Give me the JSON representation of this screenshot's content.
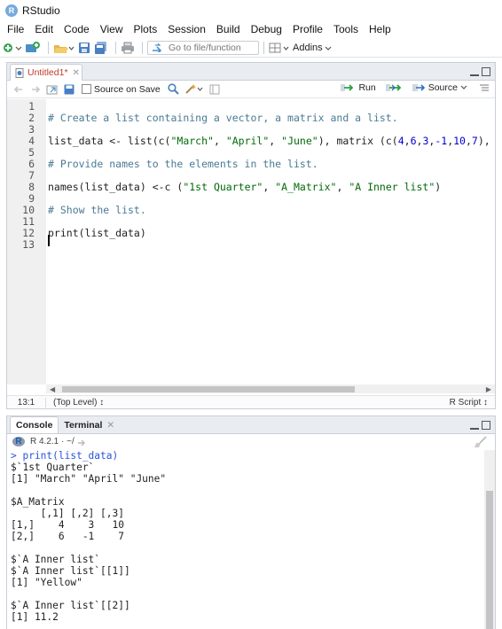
{
  "window": {
    "title": "RStudio"
  },
  "menu": [
    "File",
    "Edit",
    "Code",
    "View",
    "Plots",
    "Session",
    "Build",
    "Debug",
    "Profile",
    "Tools",
    "Help"
  ],
  "toolbar": {
    "goto_placeholder": "Go to file/function",
    "addins_label": "Addins"
  },
  "editor": {
    "tab_label": "Untitled1*",
    "source_on_save_label": "Source on Save",
    "run_label": "Run",
    "source_label": "Source",
    "lines": [
      {
        "num": "1",
        "code": ""
      },
      {
        "num": "2",
        "code": "# Create a list containing a vector, a matrix and a list."
      },
      {
        "num": "3",
        "code": ""
      },
      {
        "num": "4",
        "code": "list_data <- list(c(\"March\", \"April\", \"June\"), matrix (c(4,6,3,-1,10,7),"
      },
      {
        "num": "5",
        "code": ""
      },
      {
        "num": "6",
        "code": "# Provide names to the elements in the list."
      },
      {
        "num": "7",
        "code": ""
      },
      {
        "num": "8",
        "code": "names(list_data) <-c (\"1st Quarter\", \"A_Matrix\", \"A Inner list\")"
      },
      {
        "num": "9",
        "code": ""
      },
      {
        "num": "10",
        "code": "# Show the list."
      },
      {
        "num": "11",
        "code": ""
      },
      {
        "num": "12",
        "code": "print(list_data)"
      },
      {
        "num": "13",
        "code": ""
      }
    ],
    "status": {
      "position": "13:1",
      "scope": "(Top Level) ↕",
      "file_type": "R Script ↕"
    }
  },
  "console": {
    "tabs": [
      "Console",
      "Terminal"
    ],
    "r_version": "R 4.2.1 · ~/",
    "output": [
      "> print(list_data)",
      "$`1st Quarter`",
      "[1] \"March\" \"April\" \"June\"",
      "",
      "$A_Matrix",
      "     [,1] [,2] [,3]",
      "[1,]    4    3   10",
      "[2,]    6   -1    7",
      "",
      "$`A Inner list`",
      "$`A Inner list`[[1]]",
      "[1] \"Yellow\"",
      "",
      "$`A Inner list`[[2]]",
      "[1] 11.2"
    ]
  },
  "colors": {
    "comment": "#4a7a94",
    "string": "#036a07",
    "number": "#0000cd",
    "prompt": "#2a54d9",
    "unsaved_tab": "#c0392b"
  }
}
